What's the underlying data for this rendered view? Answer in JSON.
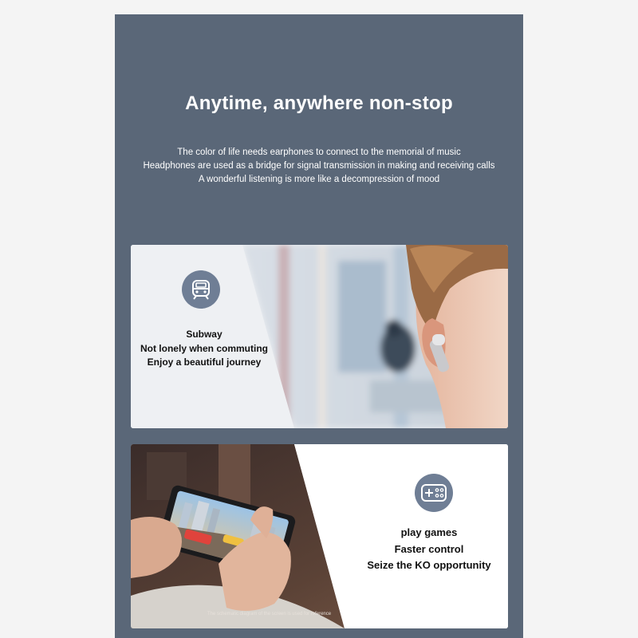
{
  "hero": {
    "title": "Anytime, anywhere non-stop",
    "lines": [
      "The color of life needs earphones to connect to the memorial of music",
      "Headphones are used as a bridge for signal transmission in making and receiving calls",
      "A wonderful listening is more like a decompression of mood"
    ]
  },
  "cards": [
    {
      "icon": "subway-icon",
      "lines": [
        "Subway",
        "Not lonely when commuting",
        "Enjoy a beautiful journey"
      ]
    },
    {
      "icon": "gamepad-icon",
      "lines": [
        "play games",
        "Faster control",
        "Seize the KO opportunity"
      ],
      "disclaimer": "The schematic diagram of the screen is used for reference"
    }
  ],
  "colors": {
    "panel": "#5a6778",
    "icon_circle": "#6f7e95",
    "page_background": "#f4f4f4"
  }
}
